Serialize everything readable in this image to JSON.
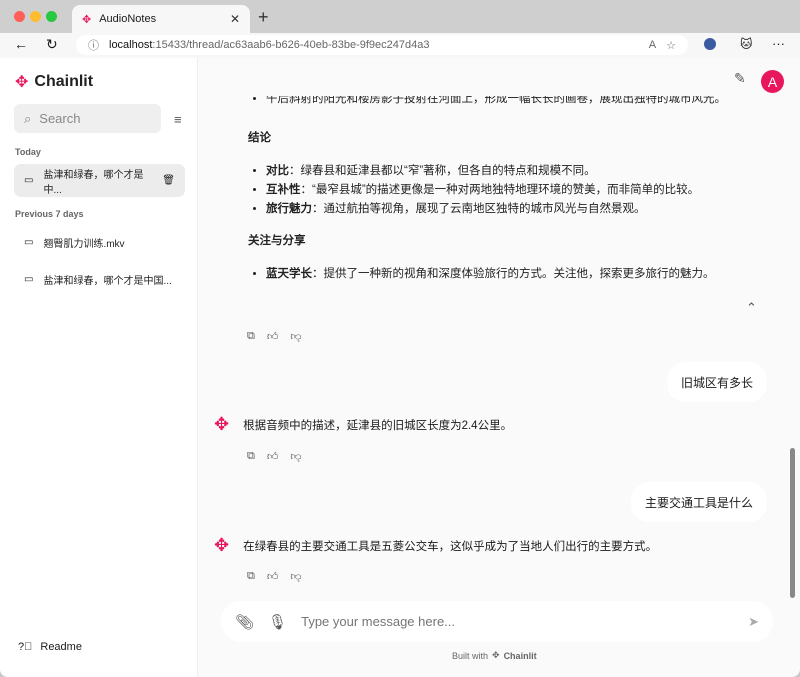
{
  "browser": {
    "tab_title": "AudioNotes",
    "url_host": "localhost",
    "url_rest": ":15433/thread/ac63aab6-b626-40eb-83be-9f9ec247d4a3"
  },
  "sidebar": {
    "brand": "Chainlit",
    "search_placeholder": "Search",
    "groups": [
      {
        "label": "Today",
        "items": [
          {
            "label": "盐津和绿春，哪个才是中..."
          }
        ]
      },
      {
        "label": "Previous 7 days",
        "items": [
          {
            "label": "翘臀肌力训练.mkv"
          },
          {
            "label": "盐津和绿春，哪个才是中国..."
          }
        ]
      }
    ],
    "readme": "Readme"
  },
  "header": {
    "avatar": "A"
  },
  "thread": {
    "partial_line": "午后斜射的阳光和楼房影子投射在河面上，形成一幅长长的画卷，展现出独特的城市风光。",
    "conclusion_title": "结论",
    "conclusion": [
      {
        "term": "对比",
        "text": "：绿春县和延津县都以“窄”著称，但各自的特点和规模不同。"
      },
      {
        "term": "互补性",
        "text": "：“最窄县城”的描述更像是一种对两地独特地理环境的赞美，而非简单的比较。"
      },
      {
        "term": "旅行魅力",
        "text": "：通过航拍等视角，展现了云南地区独特的城市风光与自然景观。"
      }
    ],
    "share_title": "关注与分享",
    "share": [
      {
        "term": "蓝天学长",
        "text": "：提供了一种新的视角和深度体验旅行的方式。关注他，探索更多旅行的魅力。"
      }
    ],
    "messages": [
      {
        "role": "user",
        "text": "旧城区有多长"
      },
      {
        "role": "assistant",
        "text": "根据音频中的描述，延津县的旧城区长度为2.4公里。"
      },
      {
        "role": "user",
        "text": "主要交通工具是什么"
      },
      {
        "role": "assistant",
        "text": "在绿春县的主要交通工具是五菱公交车，这似乎成为了当地人们出行的主要方式。"
      }
    ]
  },
  "composer": {
    "placeholder": "Type your message here..."
  },
  "footer": {
    "built_with": "Built with",
    "brand": "Chainlit"
  },
  "colors": {
    "accent": "#e8175d"
  }
}
